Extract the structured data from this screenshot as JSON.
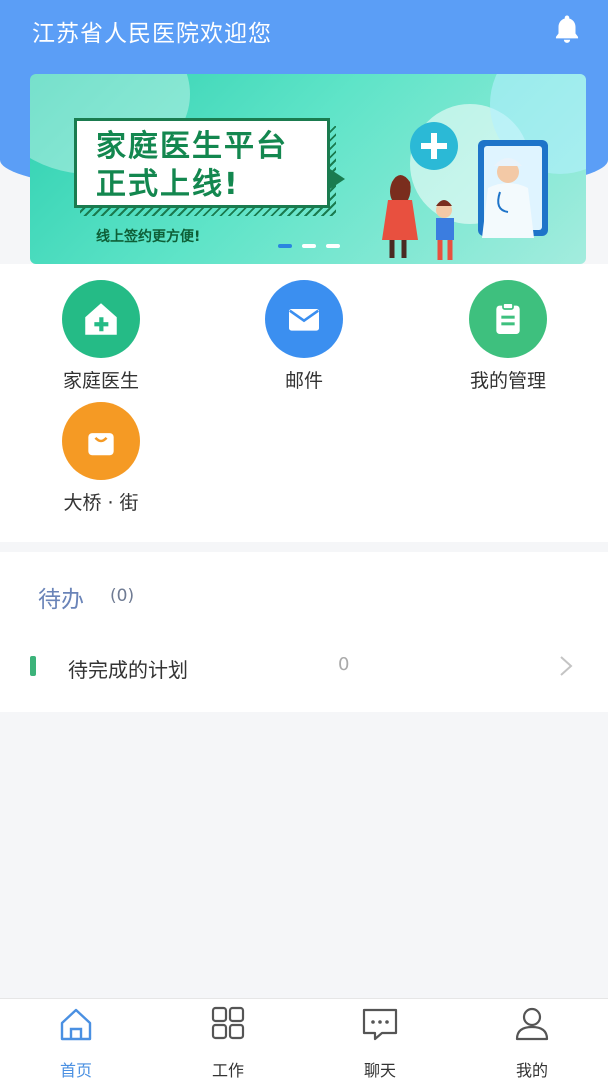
{
  "header": {
    "title": "江苏省人民医院欢迎您",
    "bell_icon": "bell-icon",
    "bg_color": "#5b9ef6"
  },
  "banner": {
    "headline_line1": "家庭医生平台",
    "headline_line2": "正式上线!",
    "subtitle": "线上签约更方便!",
    "dot_count": 3,
    "active_dot": 1
  },
  "menu": {
    "items": [
      {
        "label": "家庭医生",
        "icon": "house-plus-icon",
        "color": "#25bb86"
      },
      {
        "label": "邮件",
        "icon": "envelope-icon",
        "color": "#3b8ff0"
      },
      {
        "label": "我的管理",
        "icon": "clipboard-icon",
        "color": "#3ec07e"
      },
      {
        "label": "大桥 · 街",
        "icon": "shopping-bag-icon",
        "color": "#f59a24"
      }
    ]
  },
  "todo": {
    "title": "待办",
    "count": "(0)",
    "rows": [
      {
        "label": "待完成的计划",
        "value": "0"
      }
    ]
  },
  "tabbar": {
    "items": [
      {
        "label": "首页",
        "icon": "home-icon",
        "active": true
      },
      {
        "label": "工作",
        "icon": "grid-icon",
        "active": false
      },
      {
        "label": "聊天",
        "icon": "chat-icon",
        "active": false
      },
      {
        "label": "我的",
        "icon": "user-icon",
        "active": false
      }
    ],
    "active_color": "#4a90e2"
  }
}
